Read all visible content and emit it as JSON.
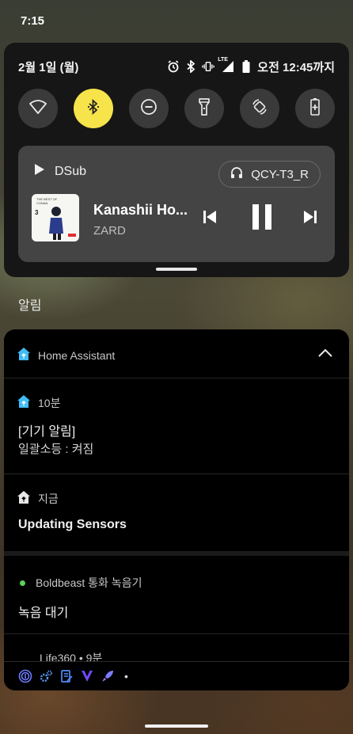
{
  "status_bar": {
    "time": "7:15"
  },
  "quick_settings": {
    "date": "2월 1일 (월)",
    "network_label": "LTE",
    "clock_text": "오전 12:45까지",
    "tiles": [
      {
        "name": "wifi",
        "active": false
      },
      {
        "name": "bluetooth",
        "active": true
      },
      {
        "name": "do-not-disturb",
        "active": false
      },
      {
        "name": "flashlight",
        "active": false
      },
      {
        "name": "auto-rotate",
        "active": false
      },
      {
        "name": "battery-saver",
        "active": false
      }
    ],
    "media": {
      "app_name": "DSub",
      "output_device": "QCY-T3_R",
      "title": "Kanashii Ho...",
      "artist": "ZARD",
      "album_art_text": "THE BEST OF CONAN",
      "album_art_number": "3"
    }
  },
  "section_label": "알림",
  "notifications": {
    "group_app": "Home Assistant",
    "items": [
      {
        "time": "10분",
        "title": "[기기 알림]",
        "text": "일괄소등 : 켜짐"
      },
      {
        "time": "지금",
        "title": "Updating Sensors"
      }
    ],
    "recorder": {
      "app": "Boldbeast 통화 녹음기",
      "text": "녹음 대기"
    },
    "partial": {
      "app": "Life360 • 9분"
    },
    "overflow_more": "•"
  },
  "colors": {
    "accent_tile": "#f7e34a",
    "ha_blue": "#41bdf5",
    "status_green": "#5bd25b"
  }
}
